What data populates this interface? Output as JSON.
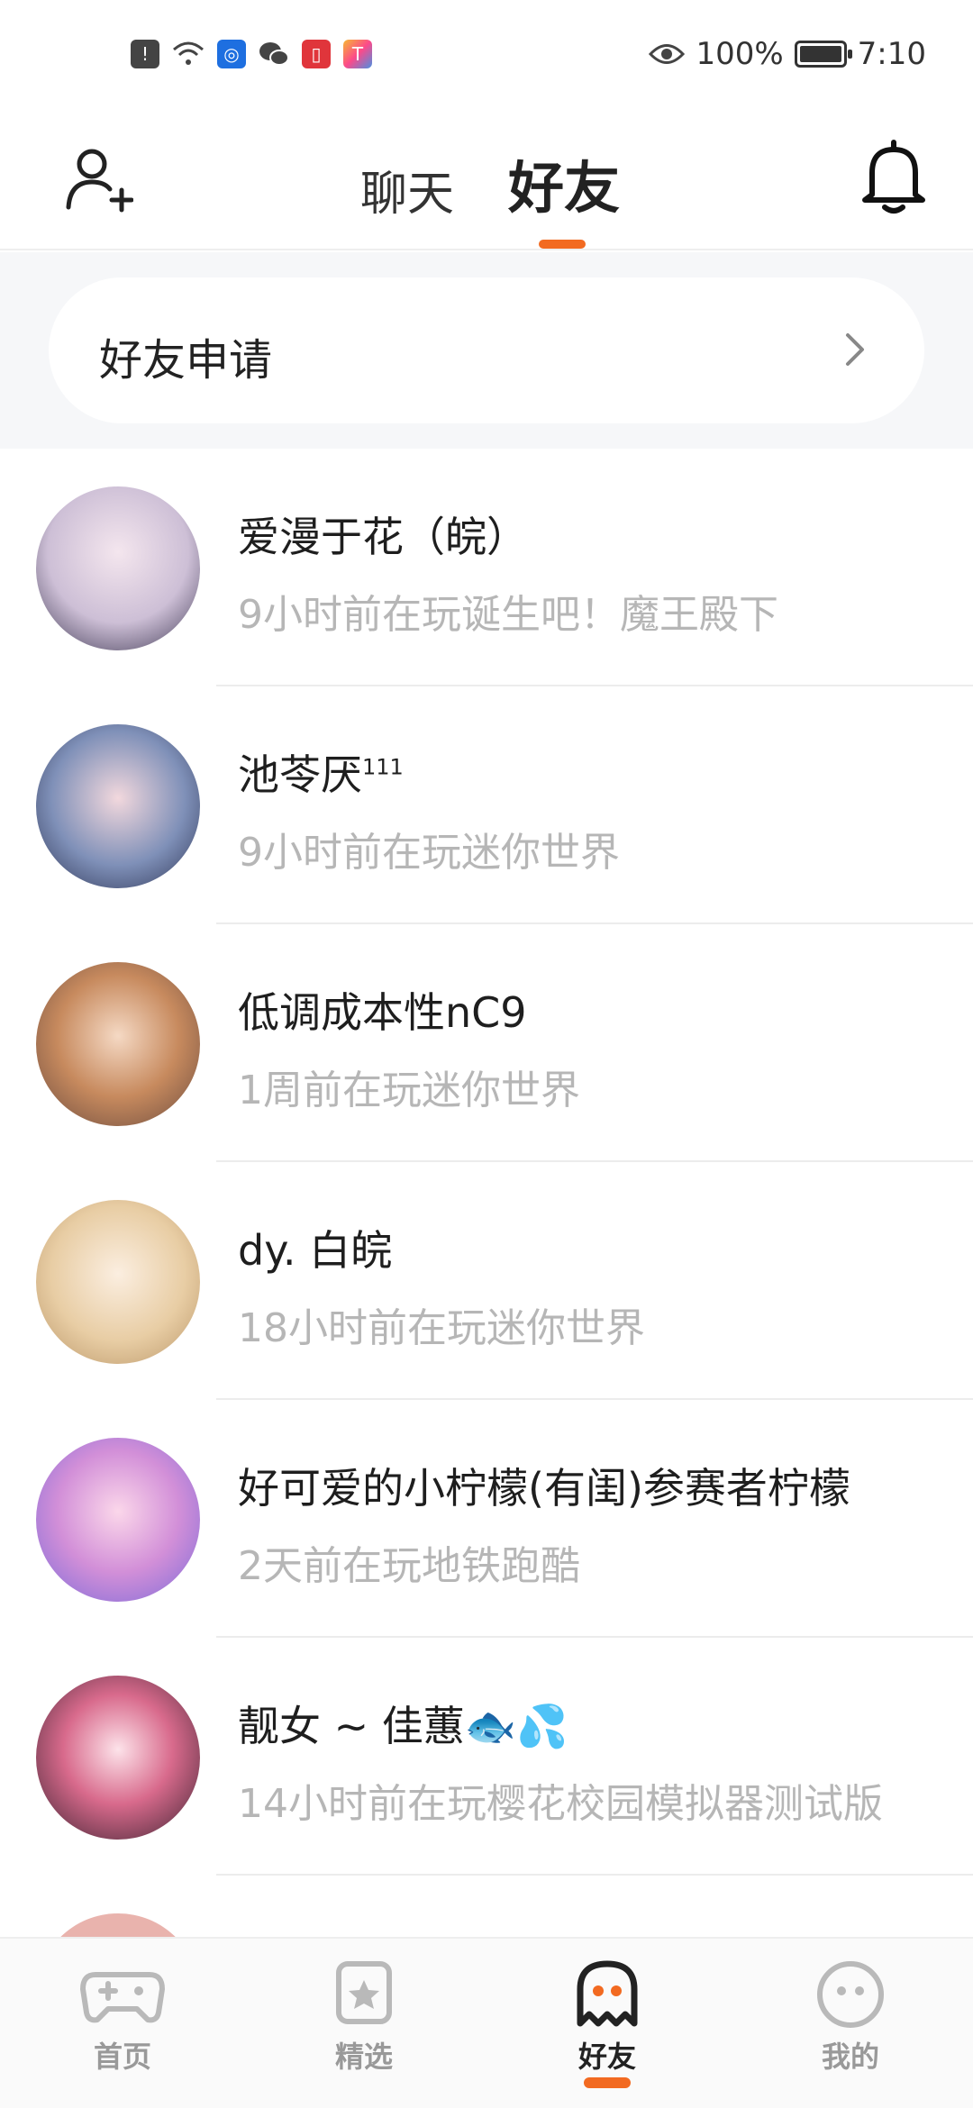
{
  "status_bar": {
    "battery": "100%",
    "time": "7:10"
  },
  "header": {
    "tabs": [
      {
        "label": "聊天",
        "active": false
      },
      {
        "label": "好友",
        "active": true
      }
    ],
    "accent_color": "#f26a21"
  },
  "friend_request": {
    "label": "好友申请"
  },
  "friends": [
    {
      "name": "爱漫于花（皖）",
      "status": "9小时前在玩诞生吧！魔王殿下"
    },
    {
      "name": "池苓厌",
      "name_sup": "111",
      "status": "9小时前在玩迷你世界"
    },
    {
      "name": "低调成本性nC9",
      "status": "1周前在玩迷你世界"
    },
    {
      "name": "dy. 白皖",
      "status": "18小时前在玩迷你世界"
    },
    {
      "name": "好可爱的小柠檬(有闺)参赛者柠檬",
      "status": "2天前在玩地铁跑酷"
    },
    {
      "name": "靓女 ~ 佳蕙🐟💦",
      "status": "14小时前在玩樱花校园模拟器测试版"
    }
  ],
  "bottom_nav": [
    {
      "label": "首页",
      "icon": "gamepad-icon",
      "active": false
    },
    {
      "label": "精选",
      "icon": "star-badge-icon",
      "active": false
    },
    {
      "label": "好友",
      "icon": "ghost-icon",
      "active": true
    },
    {
      "label": "我的",
      "icon": "face-icon",
      "active": false
    }
  ]
}
